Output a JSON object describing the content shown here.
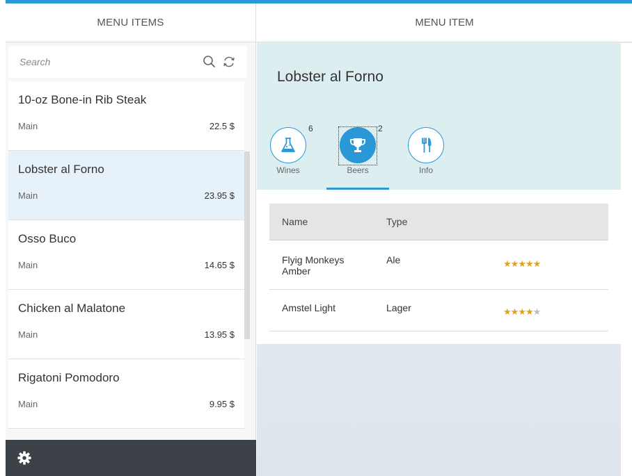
{
  "master": {
    "header": "MENU ITEMS",
    "search": {
      "placeholder": "Search",
      "value": ""
    },
    "items": [
      {
        "title": "10-oz Bone-in Rib Steak",
        "category": "Main",
        "price": "22.5 $"
      },
      {
        "title": "Lobster al Forno",
        "category": "Main",
        "price": "23.95 $"
      },
      {
        "title": "Osso Buco",
        "category": "Main",
        "price": "14.65 $"
      },
      {
        "title": "Chicken al Malatone",
        "category": "Main",
        "price": "13.95 $"
      },
      {
        "title": "Rigatoni Pomodoro",
        "category": "Main",
        "price": "9.95 $"
      }
    ],
    "selected_index": 1
  },
  "detail": {
    "header": "MENU ITEM",
    "title": "Lobster al Forno",
    "tabs": [
      {
        "label": "Wines",
        "count": "6",
        "icon": "flask-icon"
      },
      {
        "label": "Beers",
        "count": "2",
        "icon": "trophy-icon"
      },
      {
        "label": "Info",
        "count": "",
        "icon": "fork-knife-icon"
      }
    ],
    "active_tab": 1,
    "table": {
      "columns": [
        "Name",
        "Type",
        ""
      ],
      "rows": [
        {
          "name": "Flyig Monkeys Amber",
          "type": "Ale",
          "rating": 5,
          "max": 5
        },
        {
          "name": "Amstel Light",
          "type": "Lager",
          "rating": 4,
          "max": 5
        }
      ]
    }
  },
  "colors": {
    "accent": "#2a97d6",
    "footer": "#3d4248",
    "selected": "#e6f1f9",
    "star": "#e0a31c"
  }
}
